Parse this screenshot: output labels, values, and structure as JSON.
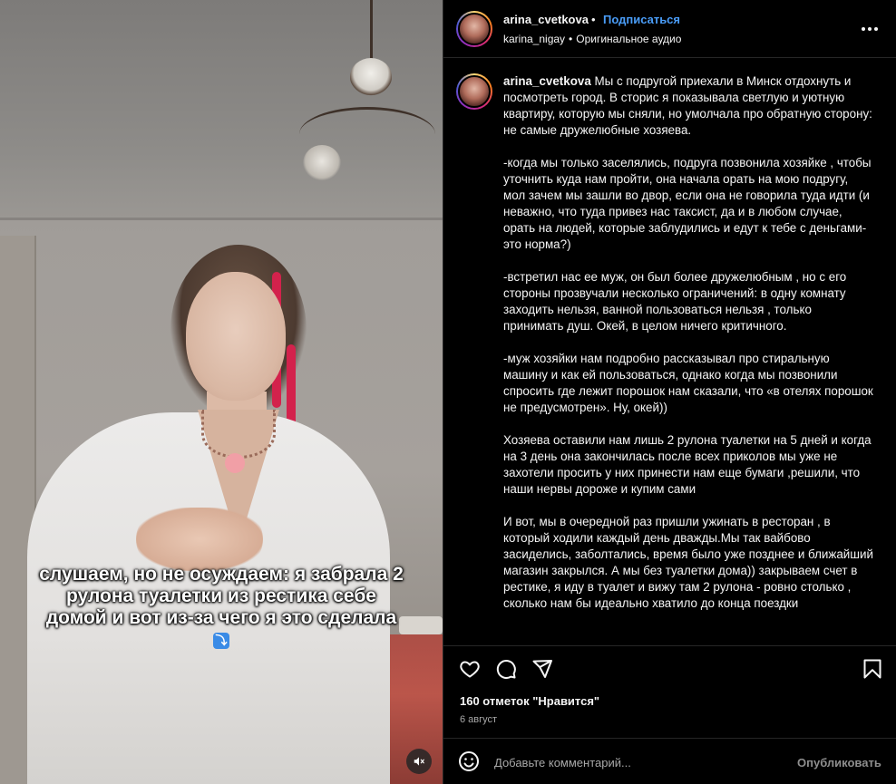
{
  "colors": {
    "accent": "#4a9df8",
    "background": "#000000",
    "text": "#f5f5f5",
    "muted": "#a8a8a8",
    "divider": "#262626"
  },
  "media": {
    "caption_text": "слушаем, но не осуждаем: я забрала 2 рулона туалетки из рестика себе домой и вот из-за чего я это сделала",
    "caption_emoji": "⤵",
    "mute_icon": "volume-muted-icon"
  },
  "header": {
    "username": "arina_cvetkova",
    "dot": "•",
    "follow_label": "Подписаться",
    "audio_author": "karina_nigay",
    "audio_sep": "•",
    "audio_label": "Оригинальное аудио",
    "more_icon": "more-horizontal-icon"
  },
  "post": {
    "username": "arina_cvetkova",
    "text": "Мы с подругой приехали в Минск отдохнуть и посмотреть город. В сторис я показывала светлую и уютную квартиру, которую мы сняли, но умолчала про обратную сторону: не самые дружелюбные хозяева.\n\n-когда мы только заселялись, подруга позвонила хозяйке , чтобы уточнить куда нам пройти, она начала орать на мою подругу, мол зачем мы зашли во двор, если она не говорила туда идти (и неважно, что туда привез нас таксист, да и в любом случае, орать на людей, которые заблудились и едут к тебе с деньгами- это норма?)\n\n-встретил нас ее муж, он был более дружелюбным , но с его стороны прозвучали несколько ограничений: в одну комнату заходить нельзя, ванной пользоваться нельзя , только принимать душ. Окей, в целом ничего критичного.\n\n-муж хозяйки нам подробно рассказывал про стиральную машину и как ей пользоваться, однако когда мы позвонили спросить где лежит порошок нам сказали, что «в отелях порошок не предусмотрен». Ну, окей))\n\nХозяева оставили нам лишь 2 рулона туалетки на 5 дней и когда на 3 день она закончилась после всех приколов мы уже не захотели просить у них принести нам еще бумаги ,решили, что наши нервы дороже и купим сами\n\nИ вот, мы в очередной раз пришли ужинать в ресторан , в который ходили каждый день дважды.Мы так вайбово засиделись, заболтались, время было уже позднее и ближайший магазин закрылся. А мы без туалетки дома)) закрываем счет в рестике, я иду в туалет и вижу там 2 рулона - ровно столько , сколько нам бы идеально хватило до конца поездки"
  },
  "actions": {
    "like_icon": "heart-icon",
    "comment_icon": "comment-icon",
    "share_icon": "share-icon",
    "save_icon": "bookmark-icon",
    "likes_text": "160 отметок \"Нравится\"",
    "date_text": "6 август"
  },
  "comment_bar": {
    "emoji_icon": "emoji-icon",
    "placeholder": "Добавьте комментарий...",
    "publish_label": "Опубликовать"
  }
}
